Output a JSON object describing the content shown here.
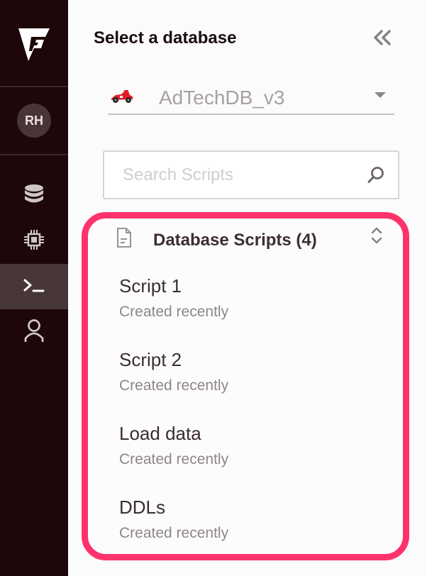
{
  "rail": {
    "avatar_initials": "RH",
    "active_item": "scripts"
  },
  "panel": {
    "title": "Select a database"
  },
  "database": {
    "selected": "AdTechDB_v3",
    "icon": "race-car-icon"
  },
  "search": {
    "placeholder": "Search Scripts",
    "value": ""
  },
  "scripts": {
    "header": "Database Scripts (4)",
    "items": [
      {
        "name": "Script 1",
        "meta": "Created recently"
      },
      {
        "name": "Script 2",
        "meta": "Created recently"
      },
      {
        "name": "Load data",
        "meta": "Created recently"
      },
      {
        "name": "DDLs",
        "meta": "Created recently"
      }
    ]
  },
  "colors": {
    "rail_bg": "#1d0709",
    "highlight_border": "#ff336c",
    "active_nav_bg": "#483738"
  }
}
